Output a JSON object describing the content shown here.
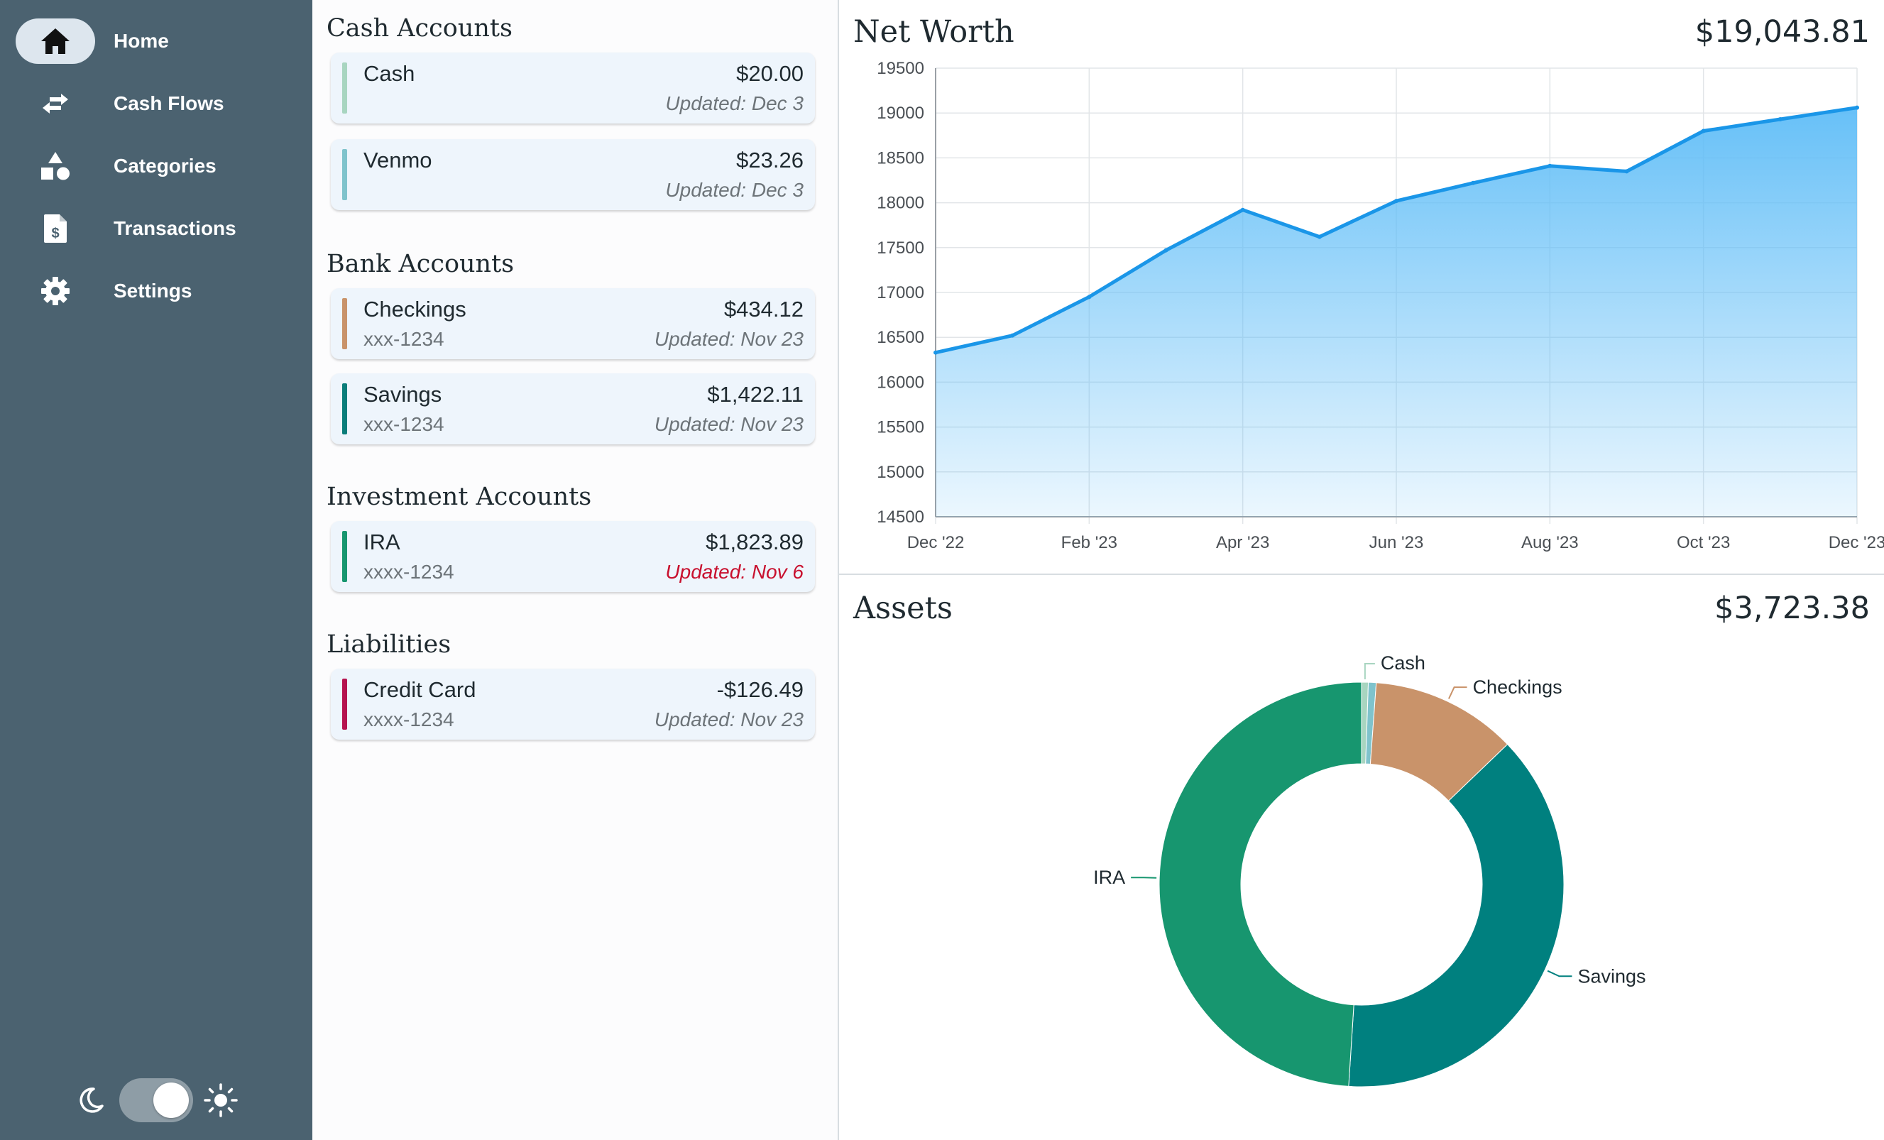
{
  "sidebar": {
    "items": [
      {
        "label": "Home",
        "icon": "home-icon",
        "active": true
      },
      {
        "label": "Cash Flows",
        "icon": "swap-arrows-icon"
      },
      {
        "label": "Categories",
        "icon": "shapes-icon"
      },
      {
        "label": "Transactions",
        "icon": "receipt-dollar-icon"
      },
      {
        "label": "Settings",
        "icon": "gear-icon"
      }
    ],
    "theme": {
      "mode": "light"
    }
  },
  "accounts": {
    "cash": {
      "title": "Cash Accounts",
      "items": [
        {
          "name": "Cash",
          "amount": "$20.00",
          "sub": "",
          "updated": "Updated: Dec 3",
          "color": "#a8d5c0"
        },
        {
          "name": "Venmo",
          "amount": "$23.26",
          "sub": "",
          "updated": "Updated: Dec 3",
          "color": "#7fc3cc"
        }
      ]
    },
    "bank": {
      "title": "Bank Accounts",
      "items": [
        {
          "name": "Checkings",
          "amount": "$434.12",
          "sub": "xxx-1234",
          "updated": "Updated: Nov 23",
          "color": "#c9936a"
        },
        {
          "name": "Savings",
          "amount": "$1,422.11",
          "sub": "xxx-1234",
          "updated": "Updated: Nov 23",
          "color": "#0a7d7a"
        }
      ]
    },
    "investment": {
      "title": "Investment Accounts",
      "items": [
        {
          "name": "IRA",
          "amount": "$1,823.89",
          "sub": "xxxx-1234",
          "updated": "Updated: Nov 6",
          "color": "#17966f",
          "stale": true
        }
      ]
    },
    "liabilities": {
      "title": "Liabilities",
      "items": [
        {
          "name": "Credit Card",
          "amount": "-$126.49",
          "sub": "xxxx-1234",
          "updated": "Updated: Nov 23",
          "color": "#b5134f"
        }
      ]
    }
  },
  "net_worth": {
    "title": "Net Worth",
    "total": "$19,043.81"
  },
  "assets": {
    "title": "Assets",
    "total": "$3,723.38"
  },
  "chart_data": [
    {
      "type": "area",
      "title": "Net Worth",
      "x": [
        "2022-12-01",
        "2023-01-01",
        "2023-02-01",
        "2023-03-01",
        "2023-04-01",
        "2023-05-01",
        "2023-06-01",
        "2023-07-01",
        "2023-08-01",
        "2023-09-01",
        "2023-10-01",
        "2023-11-01",
        "2023-12-01"
      ],
      "x_tick_labels": [
        "Dec '22",
        "Feb '23",
        "Apr '23",
        "Jun '23",
        "Aug '23",
        "Oct '23",
        "Dec '23"
      ],
      "values": [
        16330,
        16520,
        16950,
        17470,
        17920,
        17620,
        18020,
        18220,
        18410,
        18350,
        18800,
        18930,
        19060
      ],
      "ylim": [
        14500,
        19500
      ],
      "y_ticks": [
        14500,
        15000,
        15500,
        16000,
        16500,
        17000,
        17500,
        18000,
        18500,
        19000,
        19500
      ],
      "grid": true,
      "line_color": "#1a96e8",
      "fill_color": "#5fbdf7"
    },
    {
      "type": "pie",
      "title": "Assets",
      "donut": true,
      "categories": [
        "Cash",
        "Venmo",
        "Checkings",
        "Savings",
        "IRA"
      ],
      "values": [
        20.0,
        23.26,
        434.12,
        1422.11,
        1823.89
      ],
      "labels": [
        "Cash",
        "",
        "Checkings",
        "Savings",
        "IRA"
      ],
      "colors": [
        "#a8d5c0",
        "#7fc3cc",
        "#c9936a",
        "#00807f",
        "#17966f"
      ]
    }
  ]
}
